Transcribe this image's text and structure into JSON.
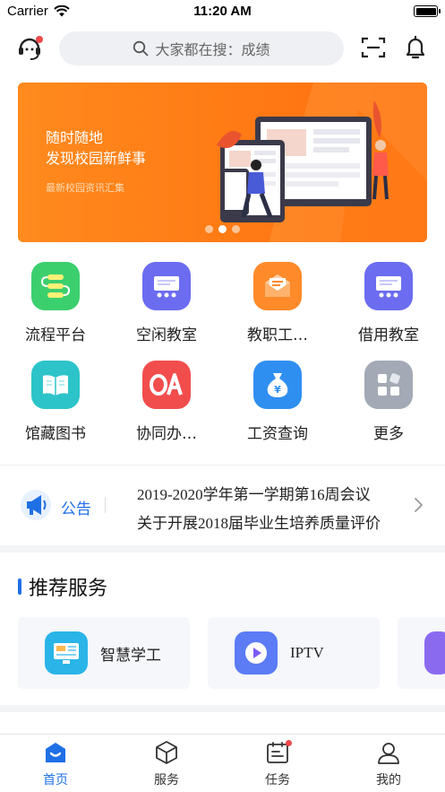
{
  "status_bar": {
    "carrier": "Carrier",
    "time": "11:20 AM"
  },
  "header": {
    "search_placeholder": "大家都在搜：成绩"
  },
  "banner": {
    "line1": "随时随地",
    "line2": "发现校园新鲜事",
    "subtitle": "最新校园资讯汇集",
    "active_dot": 1,
    "dot_count": 3
  },
  "functions": [
    {
      "label": "流程平台",
      "icon": "workflow-icon",
      "color": "#3ccf6e"
    },
    {
      "label": "空闲教室",
      "icon": "classroom-icon",
      "color": "#6b6cf0"
    },
    {
      "label": "教职工…",
      "icon": "mail-envelope-icon",
      "color": "#ff8a2a"
    },
    {
      "label": "借用教室",
      "icon": "classroom-icon",
      "color": "#6b6cf0"
    },
    {
      "label": "馆藏图书",
      "icon": "open-book-icon",
      "color": "#2cc4c9"
    },
    {
      "label": "协同办…",
      "icon": "oa-icon",
      "color": "#f24d4d"
    },
    {
      "label": "工资查询",
      "icon": "money-bag-icon",
      "color": "#2f8ff0"
    },
    {
      "label": "更多",
      "icon": "more-grid-icon",
      "color": "#a3aab5"
    }
  ],
  "notice": {
    "tag": "公告",
    "items": [
      "2019-2020学年第一学期第16周会议",
      "关于开展2018届毕业生培养质量评价"
    ]
  },
  "recommend": {
    "title": "推荐服务",
    "cards": [
      {
        "label": "智慧学工",
        "icon": "dashboard-screen-icon",
        "color": "#2ab4e8"
      },
      {
        "label": "IPTV",
        "icon": "play-icon",
        "color": "#5b7cf5"
      }
    ]
  },
  "tabbar": {
    "items": [
      {
        "label": "首页",
        "icon": "home-icon",
        "active": true
      },
      {
        "label": "服务",
        "icon": "cube-icon",
        "active": false
      },
      {
        "label": "任务",
        "icon": "task-icon",
        "active": false
      },
      {
        "label": "我的",
        "icon": "user-icon",
        "active": false
      }
    ]
  }
}
